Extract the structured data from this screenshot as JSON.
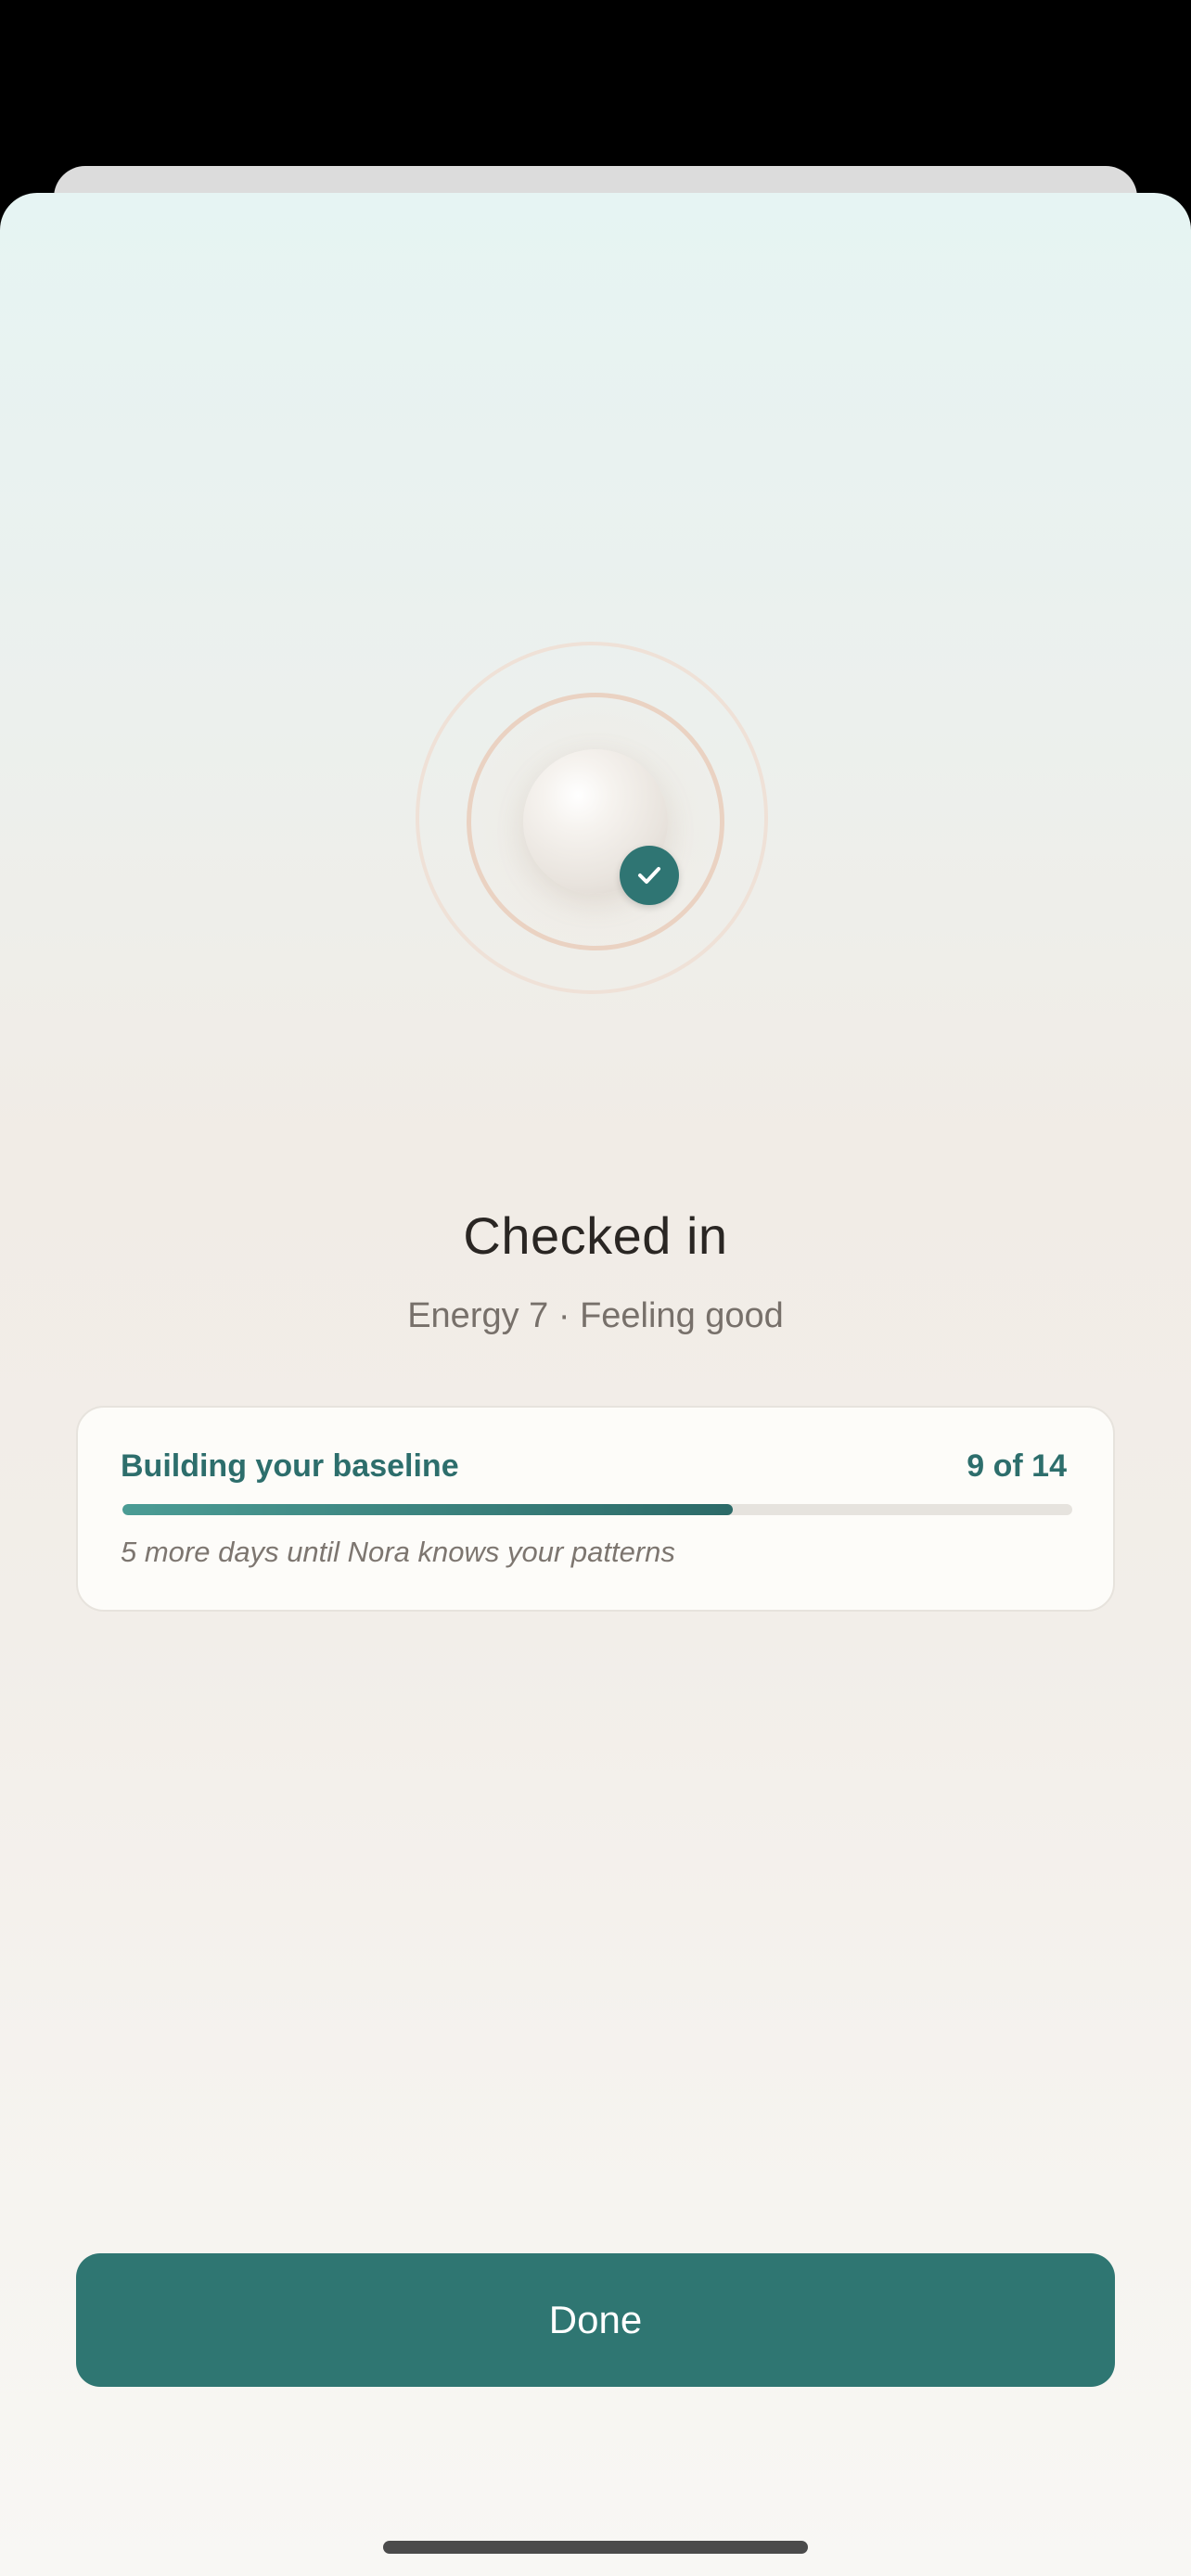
{
  "checkin": {
    "title": "Checked in",
    "summary": "Energy 7 · Feeling good"
  },
  "baseline_card": {
    "title": "Building your baseline",
    "count_label": "9 of 14",
    "progress_current": 9,
    "progress_total": 14,
    "note": "5 more days until Nora knows your patterns"
  },
  "actions": {
    "done_label": "Done"
  },
  "icons": {
    "badge": "checkmark-icon",
    "orb": "mood-orb"
  },
  "colors": {
    "accent": "#2f7672",
    "accent_text": "#2d6e6c",
    "ring": "#ead2c2"
  }
}
